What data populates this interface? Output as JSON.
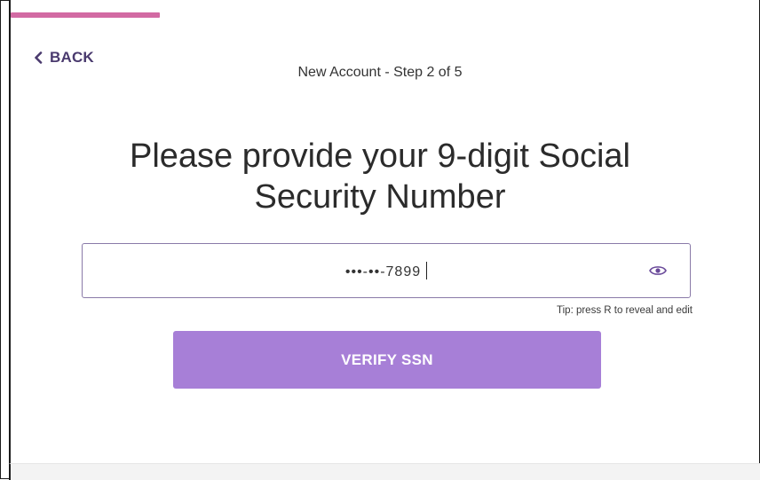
{
  "progress": {
    "fraction": 0.2,
    "color": "#d26aa3"
  },
  "nav": {
    "back_label": "BACK",
    "back_icon": "chevron-left-icon"
  },
  "header": {
    "step_text": "New Account - Step 2 of 5"
  },
  "main": {
    "title": "Please provide your 9-digit Social Security Number",
    "ssn": {
      "masked_value": "•••-••-7899",
      "toggle_icon": "eye-icon"
    },
    "tip": "Tip: press R to reveal and edit",
    "verify_label": "VERIFY SSN"
  },
  "colors": {
    "accent": "#a77fd7",
    "back_text": "#4a3a6e",
    "field_border": "#8a7aa8"
  }
}
